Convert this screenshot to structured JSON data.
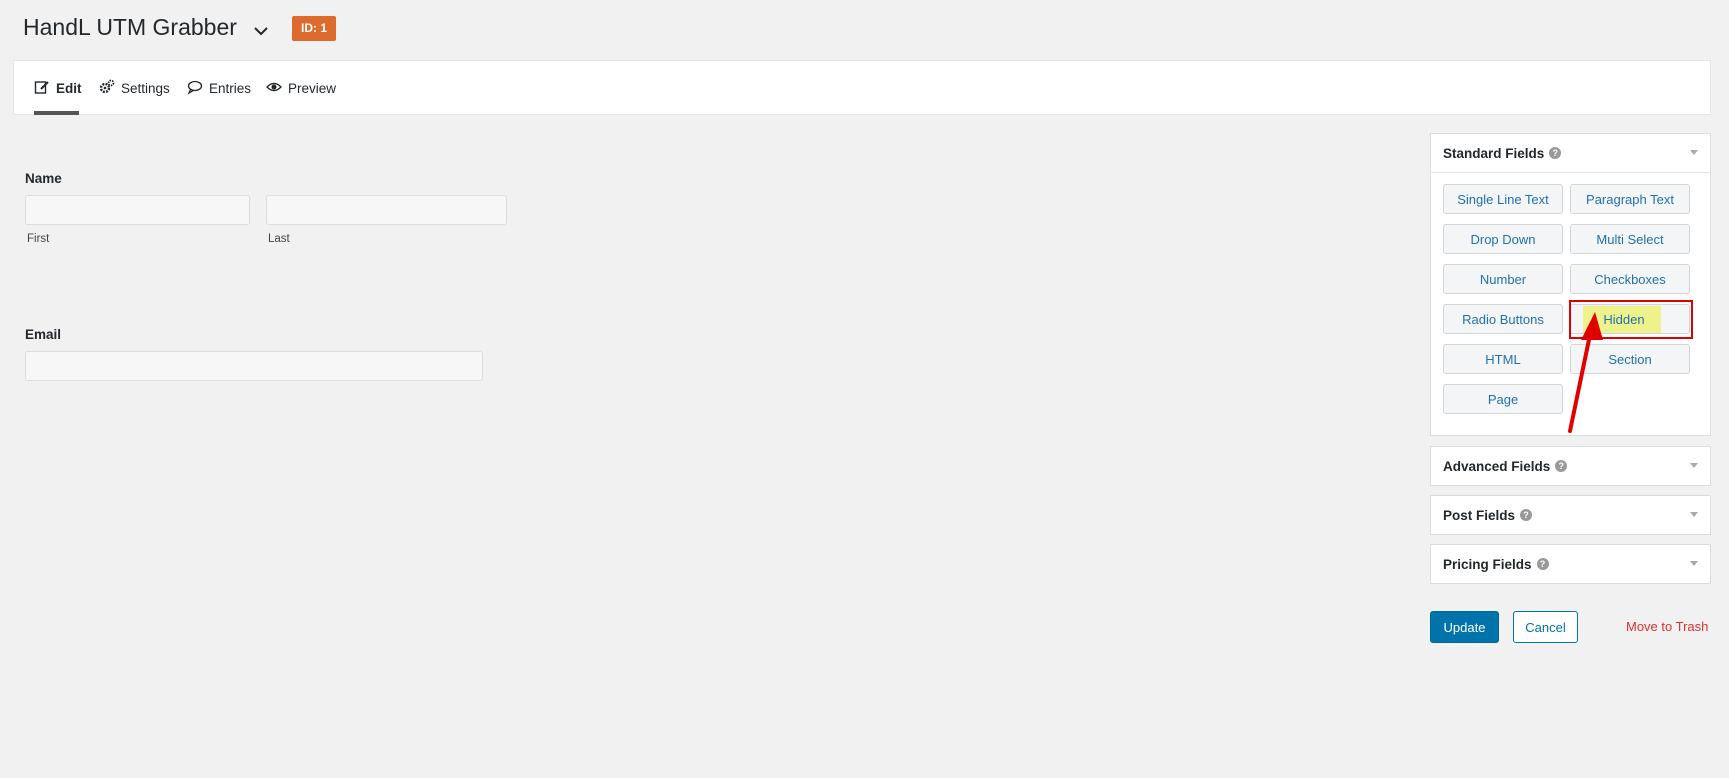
{
  "header": {
    "form_title": "HandL UTM Grabber",
    "id_badge": "ID: 1",
    "badge_color": "#dd6b2e"
  },
  "tabs": [
    {
      "label": "Edit",
      "icon": "edit-icon",
      "active": true
    },
    {
      "label": "Settings",
      "icon": "gears-icon",
      "active": false
    },
    {
      "label": "Entries",
      "icon": "comment-icon",
      "active": false
    },
    {
      "label": "Preview",
      "icon": "eye-icon",
      "active": false
    }
  ],
  "form": {
    "name_label": "Name",
    "first_label": "First",
    "last_label": "Last",
    "first_value": "",
    "last_value": "",
    "email_label": "Email",
    "email_value": ""
  },
  "panels": {
    "standard": {
      "title": "Standard Fields",
      "buttons": [
        "Single Line Text",
        "Paragraph Text",
        "Drop Down",
        "Multi Select",
        "Number",
        "Checkboxes",
        "Radio Buttons",
        "Hidden",
        "HTML",
        "Section",
        "Page"
      ],
      "highlighted": "Hidden"
    },
    "advanced": {
      "title": "Advanced Fields"
    },
    "post": {
      "title": "Post Fields"
    },
    "pricing": {
      "title": "Pricing Fields"
    }
  },
  "actions": {
    "update_label": "Update",
    "cancel_label": "Cancel",
    "trash_label": "Move to Trash"
  },
  "colors": {
    "primary": "#0073aa",
    "link": "#2271b1",
    "danger": "#dc3232",
    "annotation": "#e00000",
    "highlight": "#eef28a"
  }
}
